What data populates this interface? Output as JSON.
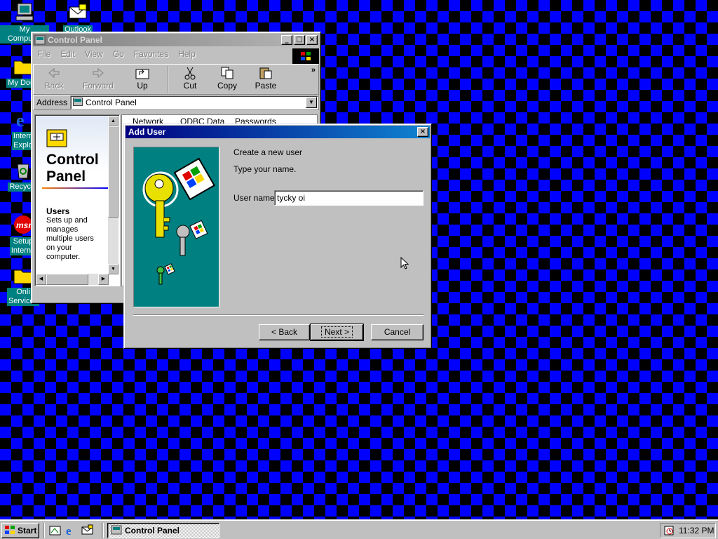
{
  "desktop": {
    "icons": [
      {
        "label": "My Computer",
        "icon": "computer-icon"
      },
      {
        "label": "Outlook",
        "icon": "outlook-icon"
      },
      {
        "label": "My Docu",
        "icon": "folder-icon"
      },
      {
        "label": "Intern\nExplo",
        "icon": "internet-explorer-icon"
      },
      {
        "label": "Recycle",
        "icon": "recycle-bin-icon"
      },
      {
        "label": "Setup\nInterne",
        "icon": "msn-icon"
      },
      {
        "label": "Onli\nServices",
        "icon": "folder-icon"
      }
    ]
  },
  "control_panel": {
    "title": "Control Panel",
    "menu": {
      "file": "File",
      "edit": "Edit",
      "view": "View",
      "go": "Go",
      "favorites": "Favorites",
      "help": "Help"
    },
    "toolbar": {
      "back": "Back",
      "forward": "Forward",
      "up": "Up",
      "cut": "Cut",
      "copy": "Copy",
      "paste": "Paste"
    },
    "address_label": "Address",
    "address_value": "Control Panel",
    "side_panel": {
      "heading_line1": "Control",
      "heading_line2": "Panel",
      "item_title": "Users",
      "item_description": "Sets up and manages multiple users on your computer."
    },
    "columns": [
      "Network",
      "ODBC Data",
      "Passwords"
    ]
  },
  "add_user_dialog": {
    "title": "Add User",
    "line1": "Create a new user",
    "line2": "Type your name.",
    "username_label": "User name:",
    "username_value": "tycky oi",
    "back_button": "< Back",
    "next_button": "Next >",
    "cancel_button": "Cancel"
  },
  "taskbar": {
    "start_label": "Start",
    "task_label": "Control Panel",
    "clock": "11:32 PM"
  },
  "colors": {
    "desktop_blue": "#0000ff",
    "titlebar_active": "#000080",
    "dialog_art_teal": "#008080",
    "window_face": "#c0c0c0"
  }
}
